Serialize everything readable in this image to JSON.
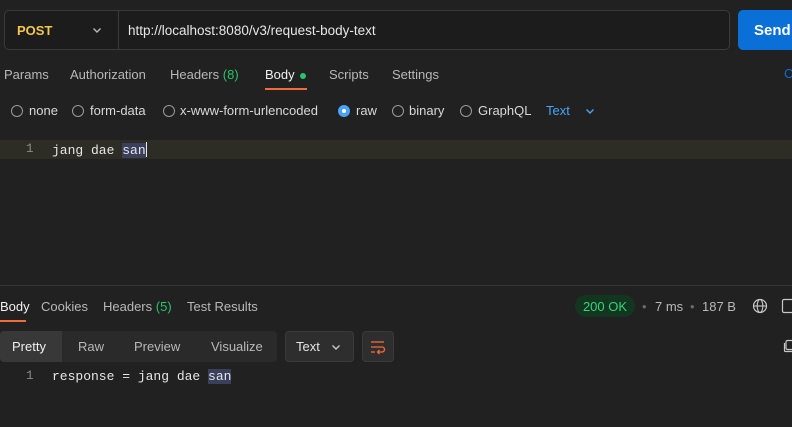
{
  "request": {
    "method": "POST",
    "url": "http://localhost:8080/v3/request-body-text",
    "send_label": "Send"
  },
  "tabs": [
    {
      "label": "Params"
    },
    {
      "label": "Authorization"
    },
    {
      "label": "Headers",
      "count": "(8)"
    },
    {
      "label": "Body"
    },
    {
      "label": "Scripts"
    },
    {
      "label": "Settings"
    }
  ],
  "tabs_right_cut": "C",
  "body_types": [
    {
      "label": "none"
    },
    {
      "label": "form-data"
    },
    {
      "label": "x-www-form-urlencoded"
    },
    {
      "label": "raw",
      "selected": true
    },
    {
      "label": "binary"
    },
    {
      "label": "GraphQL"
    }
  ],
  "body_format": "Text",
  "editor": {
    "line_number": "1",
    "text_prefix": "jang dae ",
    "text_highlight": "san"
  },
  "response": {
    "tabs": [
      {
        "label": "Body"
      },
      {
        "label": "Cookies"
      },
      {
        "label": "Headers",
        "count": "(5)"
      },
      {
        "label": "Test Results"
      }
    ],
    "status": "200 OK",
    "time": "7 ms",
    "size": "187 B",
    "view_modes": [
      "Pretty",
      "Raw",
      "Preview",
      "Visualize"
    ],
    "format": "Text",
    "line_number": "1",
    "text_prefix": "response = jang dae ",
    "text_highlight": "san"
  },
  "colors": {
    "accent": "#0b6fd8",
    "method": "#f5c84c",
    "active_tab_underline": "#f26b3a",
    "status_ok": "#37d37a"
  }
}
